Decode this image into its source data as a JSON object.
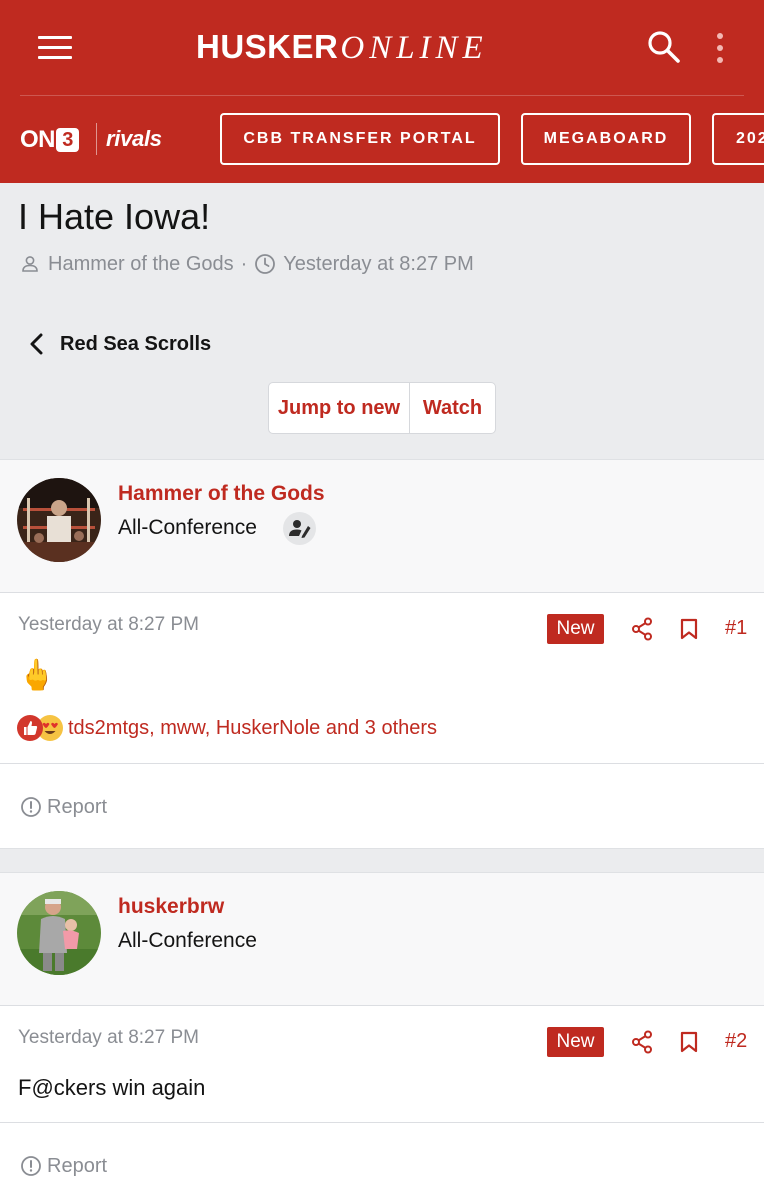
{
  "header": {
    "logo_bold": "HUSKER",
    "logo_light": "ONLINE",
    "brand_on3": "ON",
    "brand_on3_num": "3",
    "brand_rivals": "rivals",
    "nav": [
      {
        "label": "CBB TRANSFER PORTAL"
      },
      {
        "label": "MEGABOARD"
      },
      {
        "label": "202"
      }
    ],
    "colors": {
      "brand": "#bf2a20",
      "text": "#ffffff"
    }
  },
  "thread": {
    "title": "I Hate Iowa!",
    "author": "Hammer of the Gods",
    "separator": "·",
    "timestamp": "Yesterday at 8:27 PM",
    "back_label": "Red Sea Scrolls",
    "jump_label": "Jump to new",
    "watch_label": "Watch"
  },
  "posts": [
    {
      "username": "Hammer of the Gods",
      "user_title": "All-Conference",
      "date": "Yesterday at 8:27 PM",
      "badge": "New",
      "number": "#1",
      "body": "🖕",
      "reactions": [
        "like-icon",
        "love-eyes-icon"
      ],
      "reactors": "tds2mtgs, mww, HuskerNole and 3 others",
      "report_label": "Report"
    },
    {
      "username": "huskerbrw",
      "user_title": "All-Conference",
      "date": "Yesterday at 8:27 PM",
      "badge": "New",
      "number": "#2",
      "body": "F@ckers win again",
      "report_label": "Report"
    }
  ],
  "colors": {
    "accent": "#bf2a20",
    "muted": "#8a8d93",
    "background": "#ebecee"
  }
}
